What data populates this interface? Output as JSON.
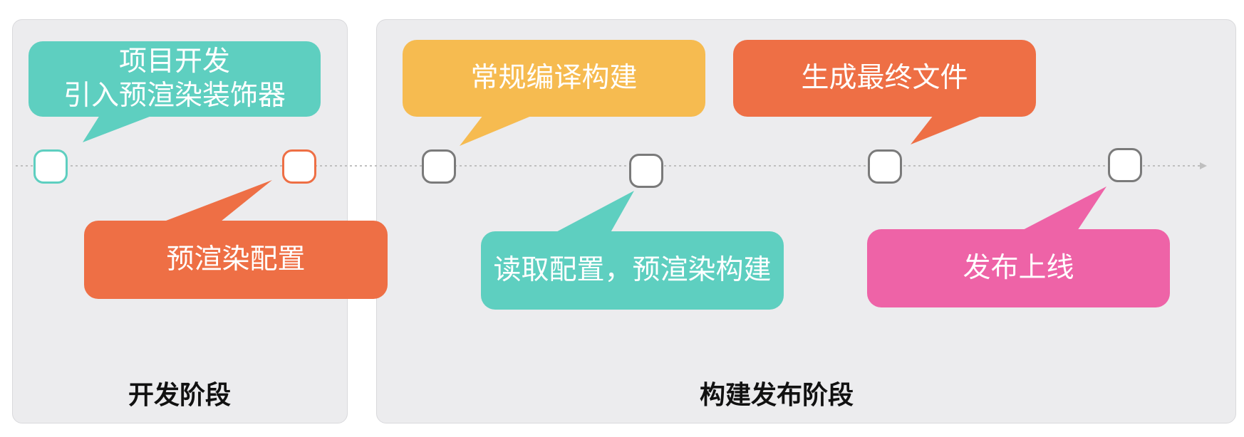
{
  "phases": {
    "development": "开发阶段",
    "build_release": "构建发布阶段"
  },
  "steps": {
    "project_dev": {
      "line1": "项目开发",
      "line2": "引入预渲染装饰器"
    },
    "prerender_config": "预渲染配置",
    "regular_build": "常规编译构建",
    "read_config_build": "读取配置，预渲染构建",
    "generate_files": "生成最终文件",
    "publish": "发布上线"
  },
  "colors": {
    "teal": "#5ecfc0",
    "orange": "#ee6f45",
    "yellow": "#f6bb50",
    "pink": "#ee63a7",
    "node_gray": "#7a7a7a",
    "panel_bg": "#ececee",
    "timeline": "#bfbfbf"
  }
}
